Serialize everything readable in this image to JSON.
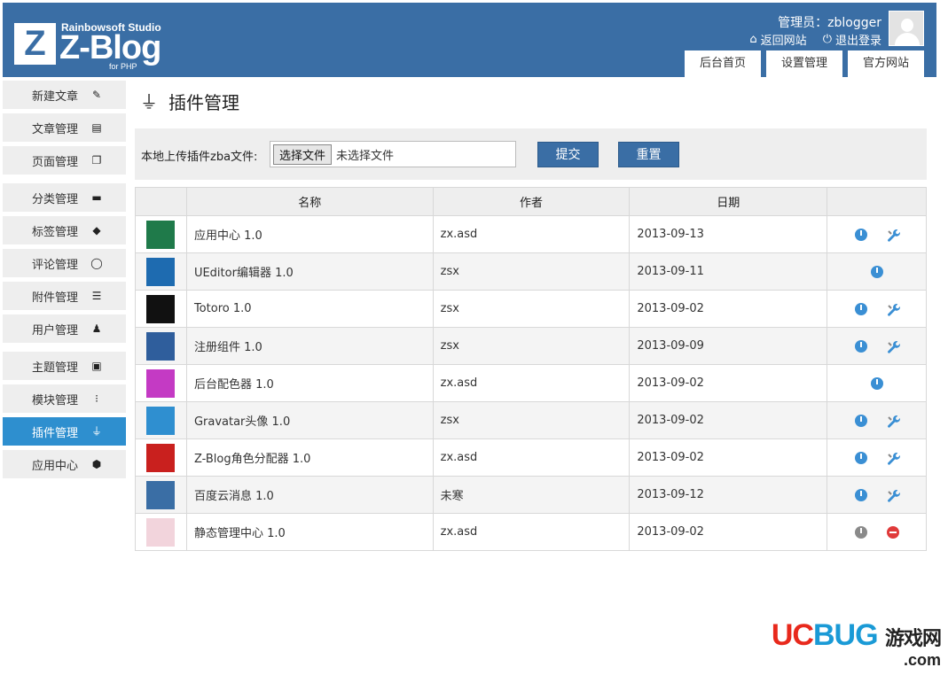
{
  "header": {
    "logo_letter": "Z",
    "studio": "Rainbowsoft Studio",
    "brand": "Z-Blog",
    "brand_sub": "for PHP",
    "admin_label": "管理员：zblogger",
    "back_site": "返回网站",
    "logout": "退出登录",
    "tabs": [
      {
        "label": "后台首页"
      },
      {
        "label": "设置管理"
      },
      {
        "label": "官方网站"
      }
    ]
  },
  "sidebar": {
    "items": [
      {
        "label": "新建文章",
        "icon": "edit-icon"
      },
      {
        "label": "文章管理",
        "icon": "document-icon"
      },
      {
        "label": "页面管理",
        "icon": "pages-icon"
      },
      {
        "label": "分类管理",
        "icon": "folder-icon"
      },
      {
        "label": "标签管理",
        "icon": "tag-icon"
      },
      {
        "label": "评论管理",
        "icon": "comment-icon"
      },
      {
        "label": "附件管理",
        "icon": "attachment-icon"
      },
      {
        "label": "用户管理",
        "icon": "user-icon"
      },
      {
        "label": "主题管理",
        "icon": "theme-icon"
      },
      {
        "label": "模块管理",
        "icon": "module-icon"
      },
      {
        "label": "插件管理",
        "icon": "plug-icon"
      },
      {
        "label": "应用中心",
        "icon": "cube-icon"
      }
    ],
    "active": "插件管理"
  },
  "main": {
    "title": "插件管理",
    "upload_label": "本地上传插件zba文件:",
    "file_button": "选择文件",
    "file_status": "未选择文件",
    "submit": "提交",
    "reset": "重置",
    "columns": [
      "名称",
      "作者",
      "日期"
    ],
    "plugins": [
      {
        "name": "应用中心 1.0",
        "author": "zx.asd",
        "date": "2013-09-13",
        "icon_color": "#1f7a4a",
        "ops": [
          "power",
          "wrench"
        ]
      },
      {
        "name": "UEditor编辑器 1.0",
        "author": "zsx",
        "date": "2013-09-11",
        "icon_color": "#1e6bb0",
        "ops": [
          "power"
        ]
      },
      {
        "name": "Totoro 1.0",
        "author": "zsx",
        "date": "2013-09-02",
        "icon_color": "#111111",
        "ops": [
          "power",
          "wrench"
        ]
      },
      {
        "name": "注册组件 1.0",
        "author": "zsx",
        "date": "2013-09-09",
        "icon_color": "#2f5e9c",
        "ops": [
          "power",
          "wrench"
        ]
      },
      {
        "name": "后台配色器 1.0",
        "author": "zx.asd",
        "date": "2013-09-02",
        "icon_color": "#c43ac4",
        "ops": [
          "power"
        ]
      },
      {
        "name": "Gravatar头像 1.0",
        "author": "zsx",
        "date": "2013-09-02",
        "icon_color": "#2f8fd0",
        "ops": [
          "power",
          "wrench"
        ]
      },
      {
        "name": "Z-Blog角色分配器 1.0",
        "author": "zx.asd",
        "date": "2013-09-02",
        "icon_color": "#c9201e",
        "ops": [
          "power",
          "wrench"
        ]
      },
      {
        "name": "百度云消息 1.0",
        "author": "未寒",
        "date": "2013-09-12",
        "icon_color": "#3a6ea5",
        "ops": [
          "power",
          "wrench"
        ]
      },
      {
        "name": "静态管理中心 1.0",
        "author": "zx.asd",
        "date": "2013-09-02",
        "icon_color": "#f2d4dc",
        "ops": [
          "power-off",
          "stop"
        ]
      }
    ]
  },
  "watermark": {
    "brand_uc": "UC",
    "brand_bug": "BUG",
    "cn": "游戏网",
    "domain": ".com"
  }
}
